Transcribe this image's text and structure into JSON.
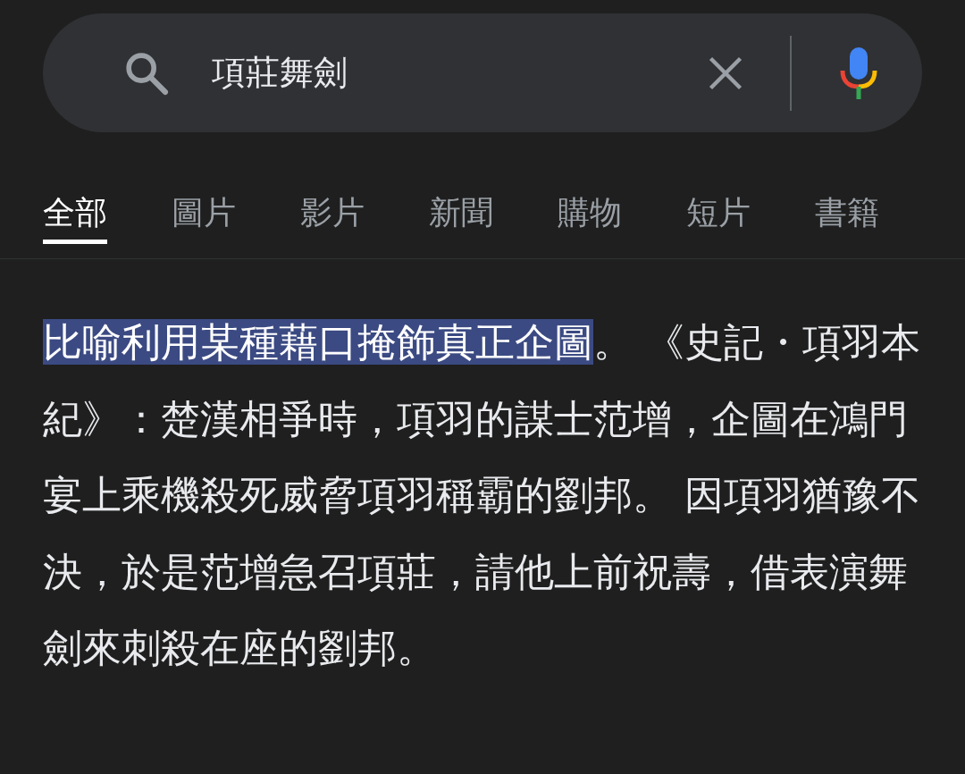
{
  "search": {
    "value": "項莊舞劍"
  },
  "tabs": [
    {
      "label": "全部",
      "selected": true
    },
    {
      "label": "圖片",
      "selected": false
    },
    {
      "label": "影片",
      "selected": false
    },
    {
      "label": "新聞",
      "selected": false
    },
    {
      "label": "購物",
      "selected": false
    },
    {
      "label": "短片",
      "selected": false
    },
    {
      "label": "書籍",
      "selected": false
    }
  ],
  "snippet": {
    "highlighted": "比喻利用某種藉口掩飾真正企圖",
    "text": "。 《史記・項羽本紀》：楚漢相爭時，項羽的謀士范增，企圖在鴻門宴上乘機殺死威脅項羽稱霸的劉邦。 因項羽猶豫不決，於是范增急召項莊，請他上前祝壽，借表演舞劍來刺殺在座的劉邦。"
  }
}
